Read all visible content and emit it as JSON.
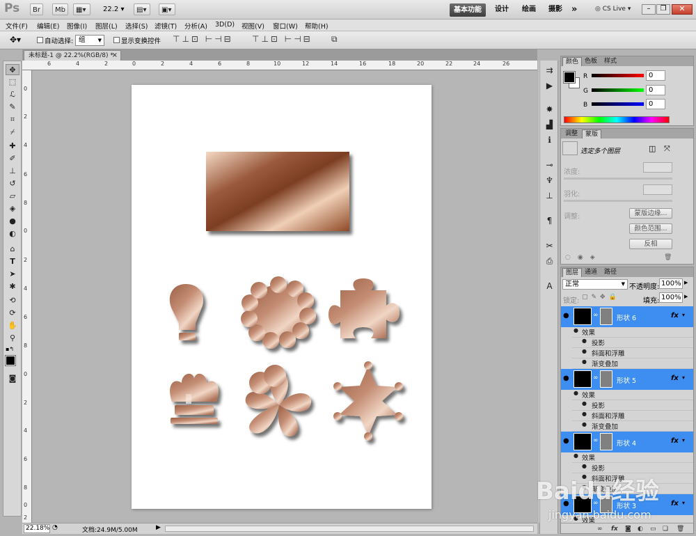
{
  "app": {
    "logo": "Ps",
    "zoom_value": "22.2"
  },
  "top": {
    "br_label": "Br",
    "mb_label": "Mb"
  },
  "workspaces": {
    "active": "基本功能",
    "items": [
      "设计",
      "绘画",
      "摄影"
    ],
    "more": "»",
    "cslive": "CS Live"
  },
  "menu": [
    "文件(F)",
    "编辑(E)",
    "图像(I)",
    "图层(L)",
    "选择(S)",
    "滤镜(T)",
    "分析(A)",
    "3D(D)",
    "视图(V)",
    "窗口(W)",
    "帮助(H)"
  ],
  "options": {
    "auto_select_label": "自动选择:",
    "auto_select_value": "组",
    "show_transform_label": "显示变换控件"
  },
  "document": {
    "tab_title": "未标题-1 @ 22.2%(RGB/8) *",
    "close": "×",
    "zoom": "22.18%",
    "status": "文档:24.9M/5.00M"
  },
  "rulers": {
    "h": [
      "6",
      "4",
      "2",
      "0",
      "2",
      "4",
      "6",
      "8",
      "10",
      "12",
      "14",
      "16",
      "18",
      "20",
      "22",
      "24",
      "26"
    ],
    "v": [
      "0",
      "2",
      "4",
      "6",
      "8",
      "0",
      "2",
      "4",
      "6",
      "8",
      "0",
      "2",
      "4",
      "6",
      "8",
      "0",
      "2"
    ]
  },
  "color_panel": {
    "tabs": [
      "颜色",
      "色板",
      "样式"
    ],
    "r_label": "R",
    "g_label": "G",
    "b_label": "B",
    "r": "0",
    "g": "0",
    "b": "0",
    "colors": {
      "fg": "#000000",
      "bg": "#ffffff"
    }
  },
  "adjust_panel": {
    "tabs": [
      "调整",
      "蒙版"
    ],
    "title": "选定多个图层",
    "density": "浓度:",
    "feather": "羽化:",
    "refine": "调整:",
    "btn_edge": "蒙版边缘...",
    "btn_range": "颜色范围...",
    "btn_invert": "反相"
  },
  "layers_panel": {
    "tabs": [
      "图层",
      "通道",
      "路径"
    ],
    "blend": "正常",
    "opacity_label": "不透明度:",
    "opacity": "100%",
    "lock_label": "锁定:",
    "fill_label": "填充:",
    "fill": "100%",
    "layers": [
      {
        "name": "形状 6",
        "effects_label": "效果",
        "effects": [
          "投影",
          "斜面和浮雕",
          "渐变叠加"
        ]
      },
      {
        "name": "形状 5",
        "effects_label": "效果",
        "effects": [
          "投影",
          "斜面和浮雕",
          "渐变叠加"
        ]
      },
      {
        "name": "形状 4",
        "effects_label": "效果",
        "effects": [
          "投影",
          "斜面和浮雕",
          "渐变叠加"
        ]
      },
      {
        "name": "形状 3",
        "effects_label": "效果",
        "effects": []
      }
    ],
    "fx": "fx",
    "accent": "#3d8ef0"
  },
  "watermark": {
    "brand": "Baidu经验",
    "url": "jingyan.baidu.com"
  }
}
